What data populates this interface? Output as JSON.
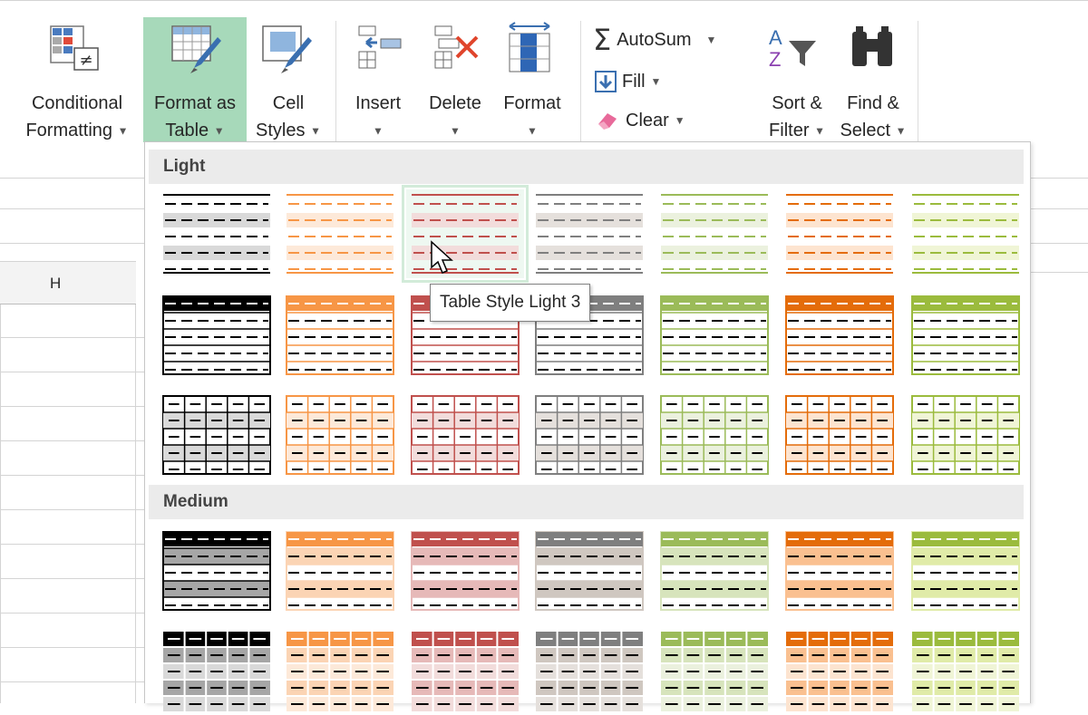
{
  "ribbon": {
    "styles": {
      "conditional_formatting": {
        "line1": "Conditional",
        "line2": "Formatting",
        "icon": "conditional-formatting-icon"
      },
      "format_as_table": {
        "line1": "Format as",
        "line2": "Table",
        "icon": "format-as-table-icon"
      },
      "cell_styles": {
        "line1": "Cell",
        "line2": "Styles",
        "icon": "cell-styles-icon"
      }
    },
    "cells": {
      "insert": {
        "label": "Insert",
        "icon": "insert-cells-icon"
      },
      "delete": {
        "label": "Delete",
        "icon": "delete-cells-icon"
      },
      "format": {
        "label": "Format",
        "icon": "format-cells-icon"
      }
    },
    "editing": {
      "autosum": {
        "label": "AutoSum",
        "icon": "sigma-icon"
      },
      "fill": {
        "label": "Fill",
        "icon": "fill-down-icon"
      },
      "clear": {
        "label": "Clear",
        "icon": "eraser-icon"
      },
      "sort_filter": {
        "line1": "Sort &",
        "line2": "Filter",
        "icon": "sort-filter-icon"
      },
      "find_select": {
        "line1": "Find &",
        "line2": "Select",
        "icon": "binoculars-icon"
      }
    }
  },
  "sheet": {
    "column_header": "H"
  },
  "gallery": {
    "sections": [
      {
        "label": "Light"
      },
      {
        "label": "Medium"
      }
    ],
    "tooltip": "Table Style Light 3",
    "hovered_style": "Table Style Light 3",
    "colors": {
      "black": "#000000",
      "orange": "#f79646",
      "red": "#c0504d",
      "gray": "#7f7f7f",
      "green": "#9bbb59",
      "darkorange": "#e46c0a",
      "lime": "#9bbb3d"
    }
  }
}
